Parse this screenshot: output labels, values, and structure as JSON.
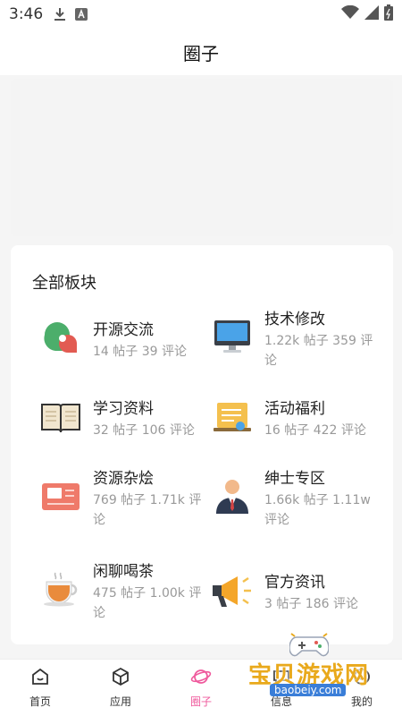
{
  "status_bar": {
    "time": "3:46",
    "icons": [
      "download-icon",
      "a-notification-icon",
      "wifi-icon",
      "signal-icon",
      "battery-icon"
    ]
  },
  "header": {
    "title": "圈子"
  },
  "boards_section": {
    "title": "全部板块",
    "items": [
      {
        "name": "开源交流",
        "stats": "14 帖子 39 评论",
        "icon": "chat-bubbles-icon"
      },
      {
        "name": "技术修改",
        "stats": "1.22k 帖子 359 评论",
        "icon": "monitor-icon"
      },
      {
        "name": "学习资料",
        "stats": "32 帖子 106 评论",
        "icon": "open-book-icon"
      },
      {
        "name": "活动福利",
        "stats": "16 帖子 422 评论",
        "icon": "notice-board-icon"
      },
      {
        "name": "资源杂烩",
        "stats": "769 帖子 1.71k 评论",
        "icon": "archive-icon"
      },
      {
        "name": "绅士专区",
        "stats": "1.66k 帖子 1.11w 评论",
        "icon": "gentleman-icon"
      },
      {
        "name": "闲聊喝茶",
        "stats": "475 帖子 1.00k 评论",
        "icon": "tea-cup-icon"
      },
      {
        "name": "官方资讯",
        "stats": "3 帖子 186 评论",
        "icon": "megaphone-icon"
      }
    ]
  },
  "tab_bar": {
    "tabs": [
      {
        "label": "首页",
        "icon": "home-icon",
        "active": false
      },
      {
        "label": "应用",
        "icon": "cube-icon",
        "active": false
      },
      {
        "label": "圈子",
        "icon": "planet-icon",
        "active": true
      },
      {
        "label": "信息",
        "icon": "message-icon",
        "active": false
      },
      {
        "label": "我的",
        "icon": "profile-icon",
        "active": false
      }
    ],
    "active_color": "#ef5a9d"
  },
  "watermark": {
    "title": "宝贝游戏网",
    "url": "baobeiy.com"
  }
}
